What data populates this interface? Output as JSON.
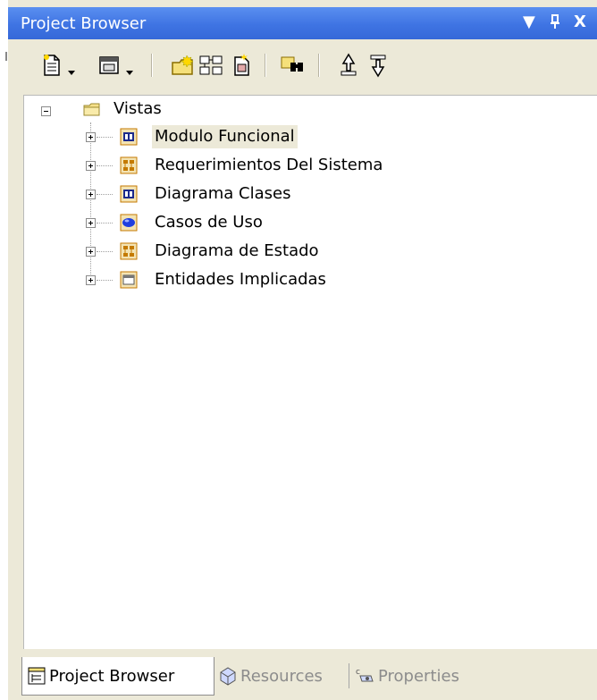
{
  "window": {
    "title": "Project Browser",
    "menu_glyph": "▼",
    "pin_glyph": "ᵖ",
    "close_glyph": "X"
  },
  "toolbar": {
    "tools": [
      {
        "name": "new-package-icon",
        "has_dropdown": true
      },
      {
        "name": "new-diagram-icon",
        "has_dropdown": true
      },
      {
        "name": "new-model-icon",
        "has_dropdown": false
      },
      {
        "name": "new-hierarchy-icon",
        "has_dropdown": false
      },
      {
        "name": "new-element-icon",
        "has_dropdown": false
      },
      {
        "name": "find-icon",
        "has_dropdown": false
      },
      {
        "name": "move-up-icon",
        "has_dropdown": false
      },
      {
        "name": "move-down-icon",
        "has_dropdown": false
      }
    ]
  },
  "tree": {
    "root": {
      "label": "Vistas",
      "expanded": true
    },
    "children": [
      {
        "label": "Modulo Funcional",
        "icon": "class-view-icon",
        "selected": true
      },
      {
        "label": "Requerimientos Del Sistema",
        "icon": "requirements-view-icon",
        "selected": false
      },
      {
        "label": "Diagrama Clases",
        "icon": "class-view-icon",
        "selected": false
      },
      {
        "label": "Casos de Uso",
        "icon": "use-case-view-icon",
        "selected": false
      },
      {
        "label": "Diagrama de Estado",
        "icon": "requirements-view-icon",
        "selected": false
      },
      {
        "label": "Entidades Implicadas",
        "icon": "entities-view-icon",
        "selected": false
      }
    ]
  },
  "tabs": [
    {
      "label": "Project Browser",
      "active": true,
      "icon": "project-browser-icon"
    },
    {
      "label": "Resources",
      "active": false,
      "icon": "resources-icon"
    },
    {
      "label": "Properties",
      "active": false,
      "icon": "properties-icon"
    }
  ]
}
